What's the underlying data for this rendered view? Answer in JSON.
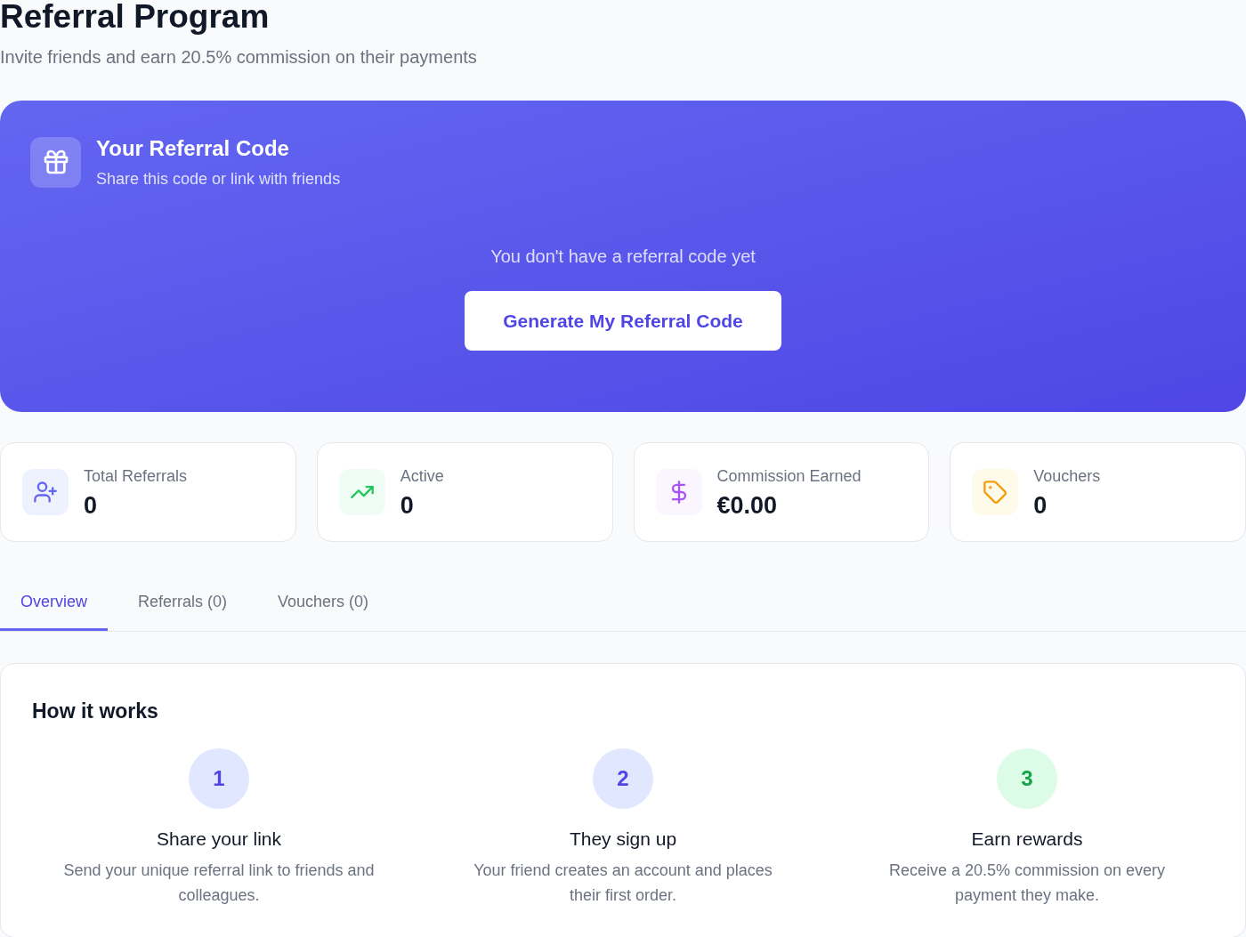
{
  "header": {
    "title": "Referral Program",
    "subtitle": "Invite friends and earn 20.5% commission on their payments"
  },
  "referral_code": {
    "title": "Your Referral Code",
    "subtitle": "Share this code or link with friends",
    "empty_message": "You don't have a referral code yet",
    "button": "Generate My Referral Code"
  },
  "stats": [
    {
      "kind": "referrals",
      "label": "Total Referrals",
      "value": "0"
    },
    {
      "kind": "active",
      "label": "Active",
      "value": "0"
    },
    {
      "kind": "commission",
      "label": "Commission Earned",
      "value": "€0.00"
    },
    {
      "kind": "vouchers",
      "label": "Vouchers",
      "value": "0"
    }
  ],
  "tabs": [
    {
      "label": "Overview",
      "selected": true
    },
    {
      "label": "Referrals (0)",
      "selected": false
    },
    {
      "label": "Vouchers (0)",
      "selected": false
    }
  ],
  "how_it_works": {
    "title": "How it works",
    "steps": [
      {
        "number": "1",
        "title": "Share your link",
        "description": "Send your unique referral link to friends and colleagues.",
        "color": "#e0e7ff"
      },
      {
        "number": "2",
        "title": "They sign up",
        "description": "Your friend creates an account and places their first order.",
        "color": "#e0e7ff"
      },
      {
        "number": "3",
        "title": "Earn rewards",
        "description": "Receive a 20.5% commission on every payment they make.",
        "color": "#dcfce7"
      }
    ]
  }
}
